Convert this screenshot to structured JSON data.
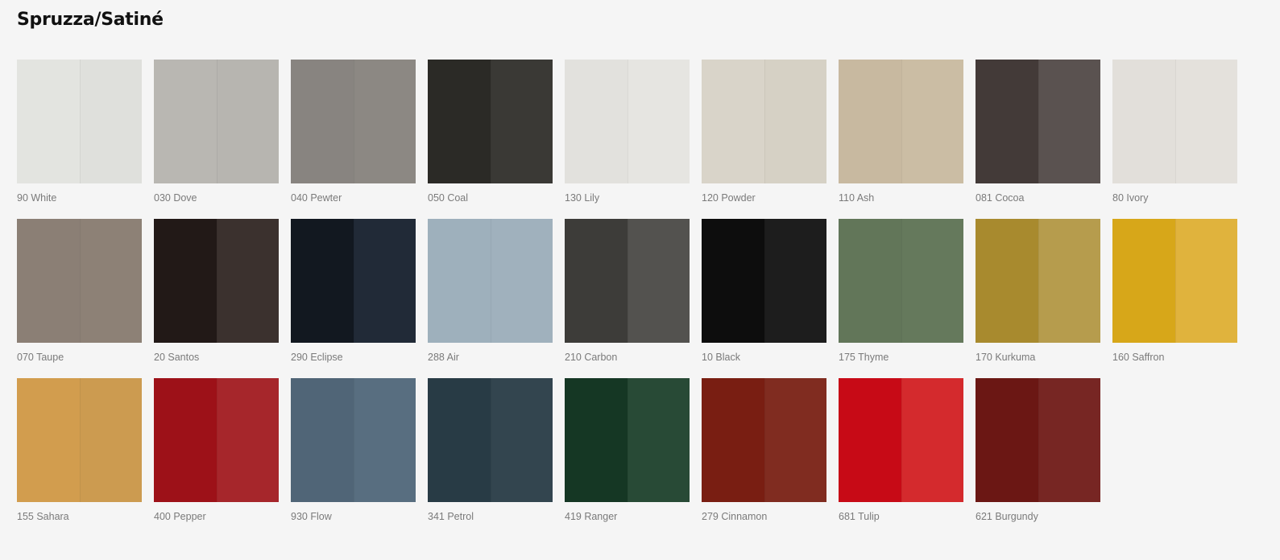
{
  "page": {
    "title": "Spruzza/Satiné"
  },
  "swatches": [
    {
      "label": "90 White",
      "color_left": "#e3e4e0",
      "color_right": "#dfe0dc"
    },
    {
      "label": "030 Dove",
      "color_left": "#b9b7b2",
      "color_right": "#b7b5b0"
    },
    {
      "label": "040 Pewter",
      "color_left": "#888480",
      "color_right": "#8c8883"
    },
    {
      "label": "050 Coal",
      "color_left": "#2b2a26",
      "color_right": "#3a3935"
    },
    {
      "label": "130 Lily",
      "color_left": "#e2e1dd",
      "color_right": "#e6e5e1"
    },
    {
      "label": "120 Powder",
      "color_left": "#d9d4c9",
      "color_right": "#d6d1c5"
    },
    {
      "label": "110 Ash",
      "color_left": "#c8b9a0",
      "color_right": "#cbbda4"
    },
    {
      "label": "081 Cocoa",
      "color_left": "#433a38",
      "color_right": "#5a5250"
    },
    {
      "label": "80 Ivory",
      "color_left": "#e2dfda",
      "color_right": "#e4e1dc"
    },
    {
      "label": "070 Taupe",
      "color_left": "#8b7f75",
      "color_right": "#8d8176"
    },
    {
      "label": "20 Santos",
      "color_left": "#221917",
      "color_right": "#3b312e"
    },
    {
      "label": "290 Eclipse",
      "color_left": "#121820",
      "color_right": "#212a37"
    },
    {
      "label": "288 Air",
      "color_left": "#9eb0bc",
      "color_right": "#a0b1bd"
    },
    {
      "label": "210 Carbon",
      "color_left": "#3d3c39",
      "color_right": "#53524f"
    },
    {
      "label": "10 Black",
      "color_left": "#0d0d0d",
      "color_right": "#1d1d1d"
    },
    {
      "label": "175 Thyme",
      "color_left": "#627659",
      "color_right": "#65795c"
    },
    {
      "label": "170 Kurkuma",
      "color_left": "#a88a2e",
      "color_right": "#b69c4d"
    },
    {
      "label": "160 Saffron",
      "color_left": "#d7a719",
      "color_right": "#e0b33d"
    },
    {
      "label": "155 Sahara",
      "color_left": "#d29d4e",
      "color_right": "#cc9b50"
    },
    {
      "label": "400 Pepper",
      "color_left": "#9d1118",
      "color_right": "#a6262b"
    },
    {
      "label": "930 Flow",
      "color_left": "#506577",
      "color_right": "#586e80"
    },
    {
      "label": "341 Petrol",
      "color_left": "#283b45",
      "color_right": "#33454f"
    },
    {
      "label": "419 Ranger",
      "color_left": "#153724",
      "color_right": "#284a36"
    },
    {
      "label": "279 Cinnamon",
      "color_left": "#791e12",
      "color_right": "#802c20"
    },
    {
      "label": "681 Tulip",
      "color_left": "#c70a16",
      "color_right": "#d42a2d"
    },
    {
      "label": "621 Burgundy",
      "color_left": "#6b1714",
      "color_right": "#772623"
    }
  ]
}
